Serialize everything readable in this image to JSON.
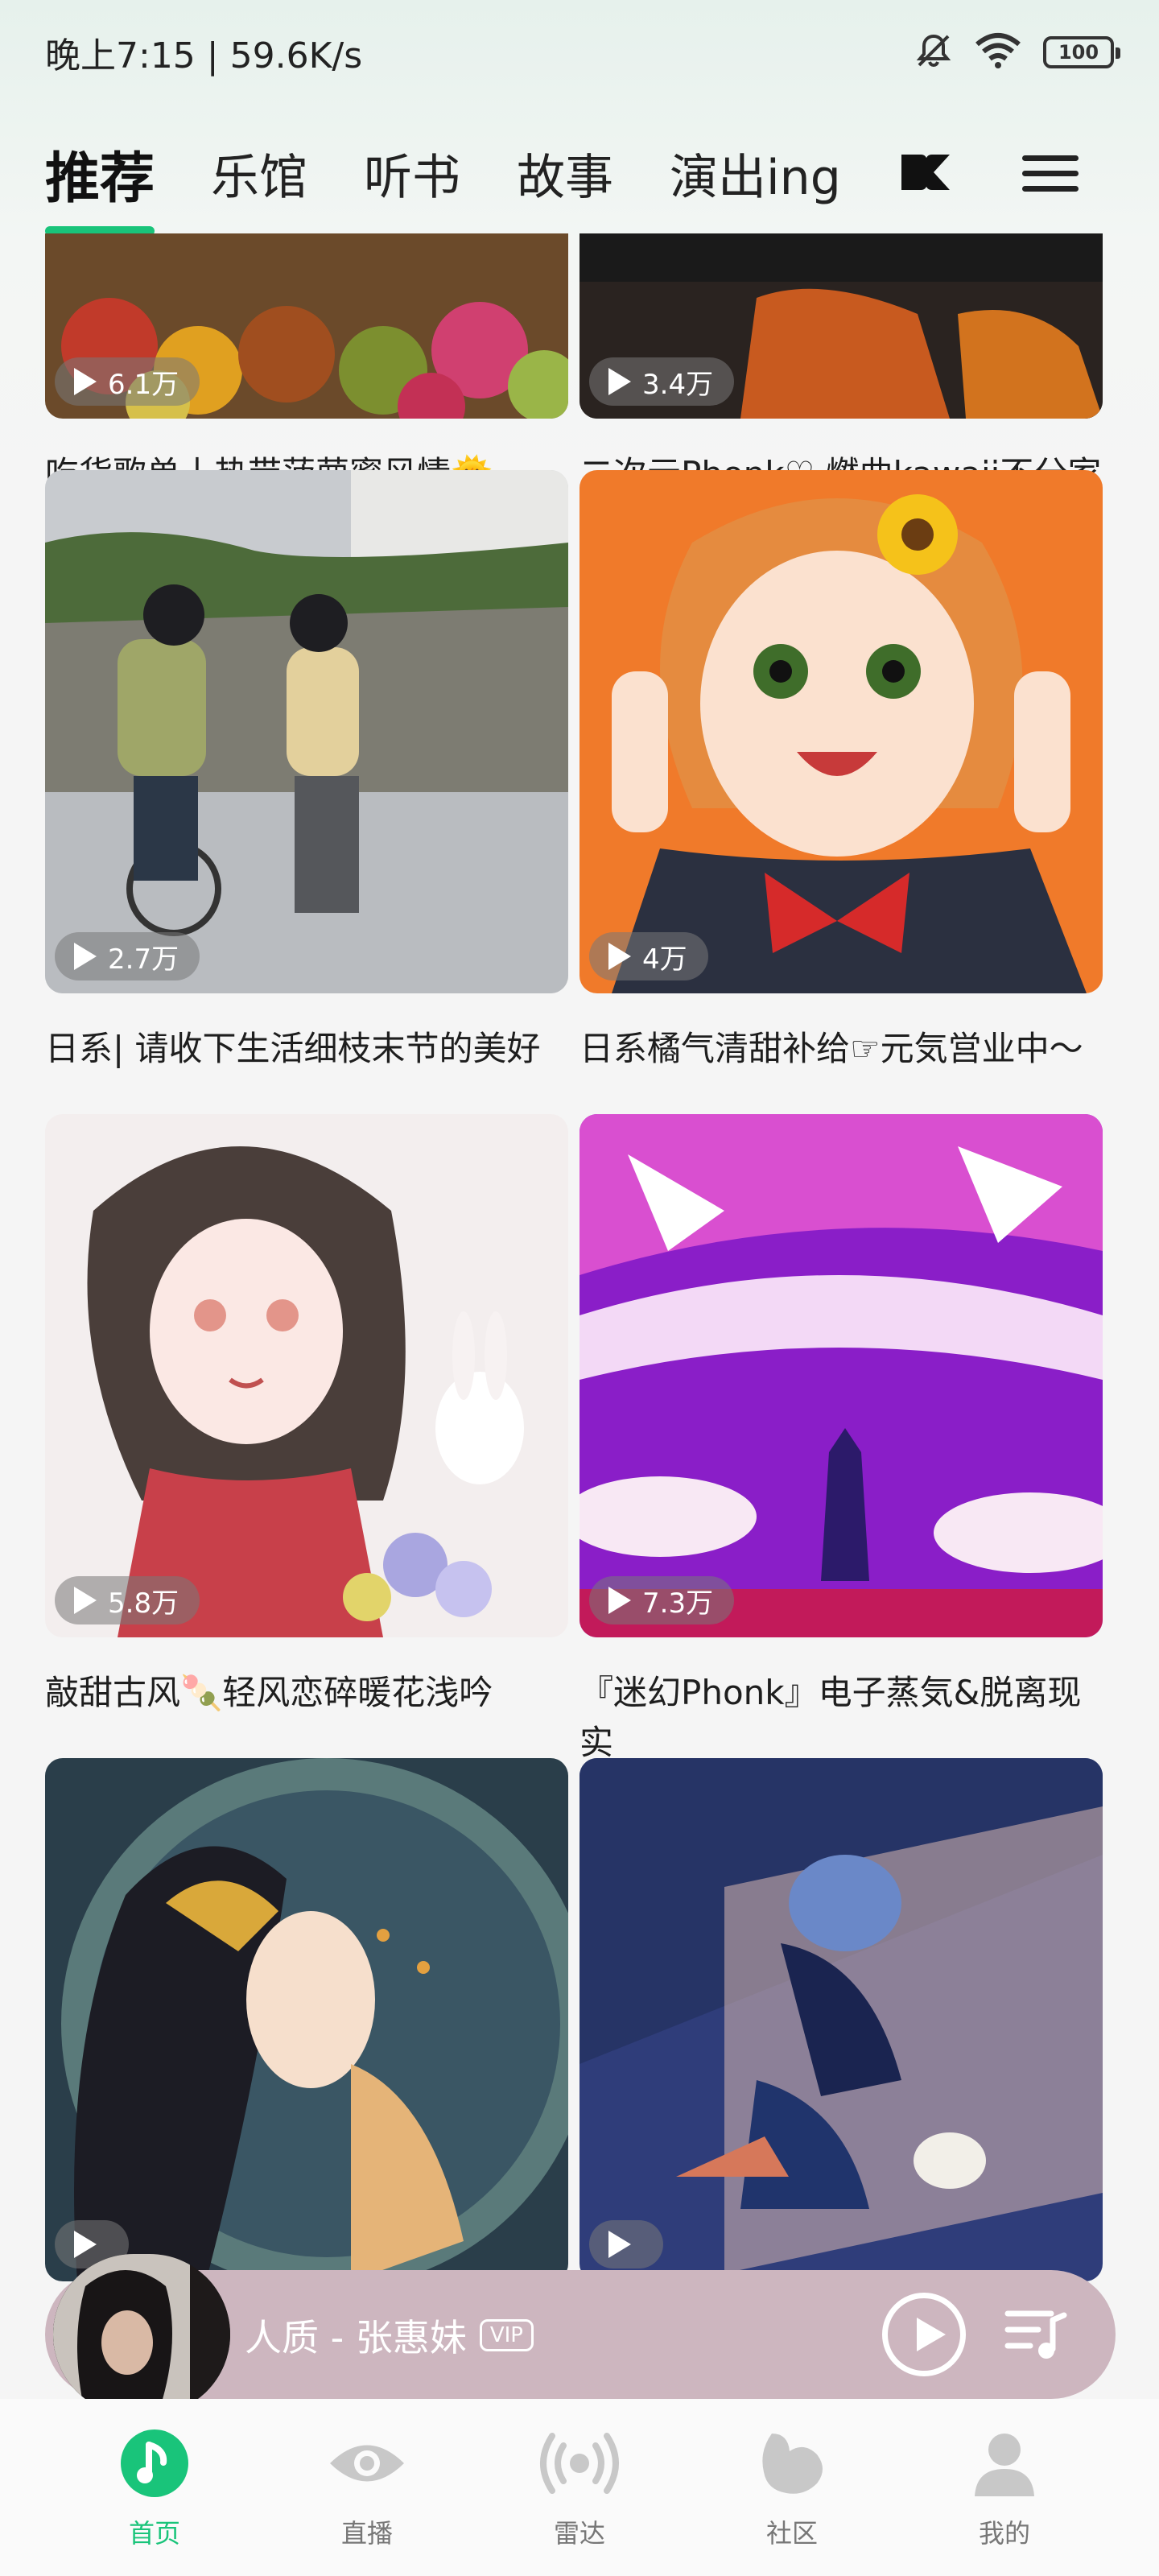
{
  "status_bar": {
    "time": "晚上7:15 | 59.6K/s",
    "battery": "100",
    "icons": [
      "mute-bell-icon",
      "wifi-icon",
      "battery-icon"
    ]
  },
  "top_tabs": {
    "items": [
      {
        "label": "推荐",
        "active": true
      },
      {
        "label": "乐馆",
        "active": false
      },
      {
        "label": "听书",
        "active": false
      },
      {
        "label": "故事",
        "active": false
      },
      {
        "label": "演出ing",
        "active": false
      }
    ],
    "extra_icons": [
      "dc-logo-icon",
      "menu-icon"
    ]
  },
  "feed": {
    "cards": [
      {
        "plays": "6.1万",
        "title": "吃货歌单丨热带菠萝蜜风情🌞"
      },
      {
        "plays": "3.4万",
        "title": "二次元Phonk♡ 燃曲kawaii不分家"
      },
      {
        "plays": "2.7万",
        "title": "日系| 请收下生活细枝末节的美好"
      },
      {
        "plays": "4万",
        "title": "日系橘气清甜补给☞元気営业中～"
      },
      {
        "plays": "5.8万",
        "title": "敲甜古风🍡轻风恋碎暖花浅吟"
      },
      {
        "plays": "7.3万",
        "title": "『迷幻Phonk』电子蒸気&脱离现实"
      },
      {
        "plays": "",
        "title": ""
      },
      {
        "plays": "",
        "title": ""
      }
    ]
  },
  "mini_player": {
    "song": "人质 - 张惠妹",
    "vip": "VIP"
  },
  "bottom_nav": {
    "items": [
      {
        "label": "首页",
        "icon": "home-note-icon",
        "active": true
      },
      {
        "label": "直播",
        "icon": "eye-icon",
        "active": false
      },
      {
        "label": "雷达",
        "icon": "radar-icon",
        "active": false
      },
      {
        "label": "社区",
        "icon": "community-icon",
        "active": false
      },
      {
        "label": "我的",
        "icon": "profile-icon",
        "active": false
      }
    ]
  },
  "colors": {
    "accent": "#19c47a",
    "player_bg": "#cdb6bf"
  }
}
